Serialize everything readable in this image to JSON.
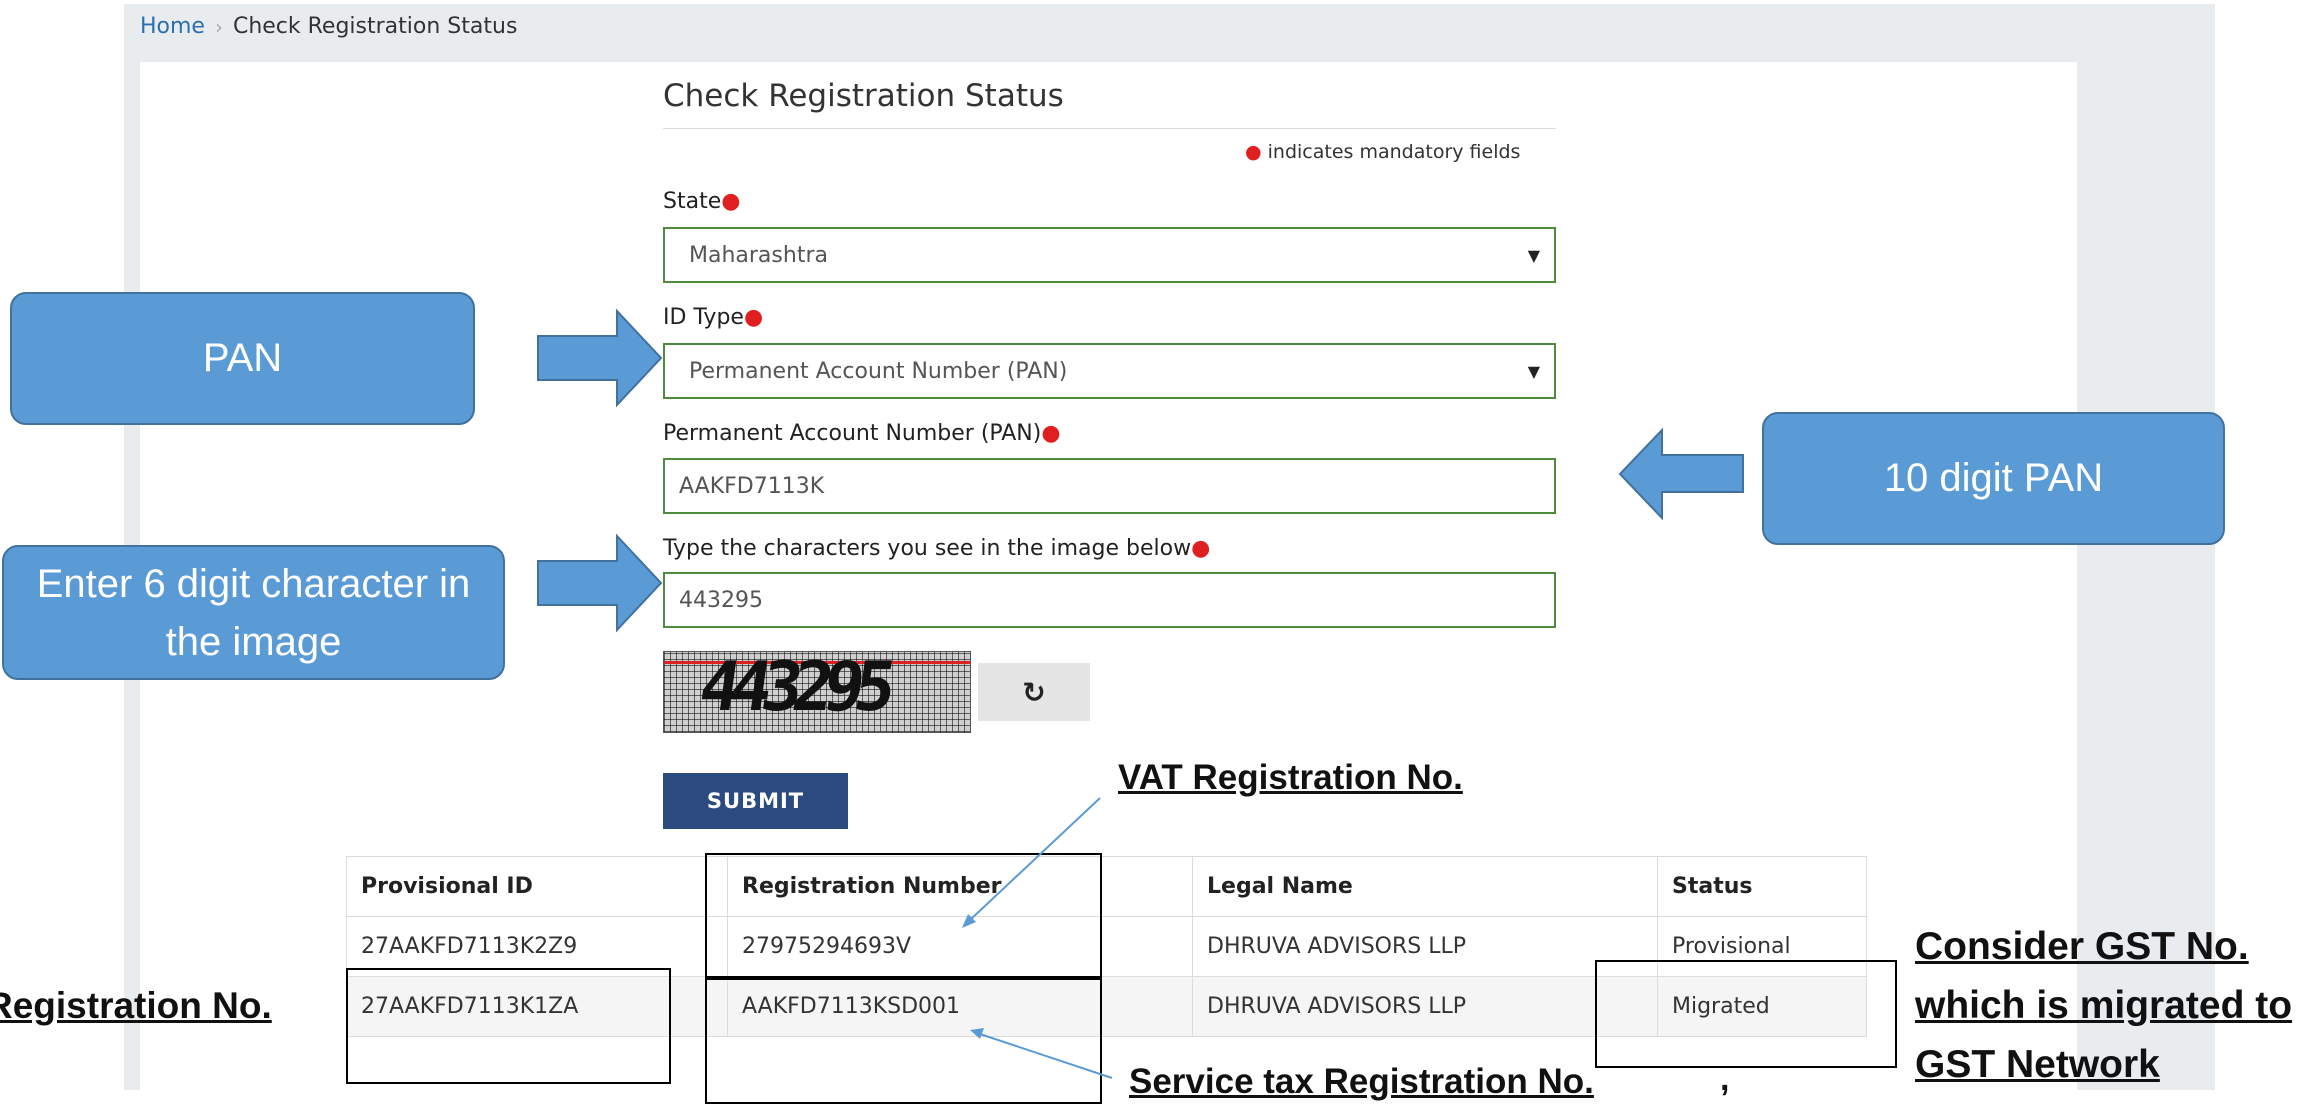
{
  "breadcrumb": {
    "home": "Home",
    "current": "Check Registration Status"
  },
  "form": {
    "title": "Check Registration Status",
    "mandatory_note": "indicates mandatory fields",
    "state_label": "State",
    "state_value": "Maharashtra",
    "id_type_label": "ID Type",
    "id_type_value": "Permanent Account Number (PAN)",
    "pan_label": "Permanent Account Number (PAN)",
    "pan_value": "AAKFD7113K",
    "captcha_label": "Type the characters you see in the image below",
    "captcha_value": "443295",
    "captcha_image_text": "443295",
    "refresh_icon": "refresh-icon",
    "submit_label": "SUBMIT"
  },
  "table": {
    "headers": [
      "Provisional ID",
      "Registration Number",
      "Legal Name",
      "Status"
    ],
    "rows": [
      [
        "27AAKFD7113K2Z9",
        "27975294693V",
        "DHRUVA ADVISORS LLP",
        "Provisional"
      ],
      [
        "27AAKFD7113K1ZA",
        "AAKFD7113KSD001",
        "DHRUVA ADVISORS LLP",
        "Migrated"
      ]
    ]
  },
  "annotations": {
    "callout_pan": "PAN",
    "callout_10digit": "10 digit PAN",
    "callout_captcha": "Enter 6 digit character in the image",
    "vat_label": "VAT Registration No.",
    "service_tax_label": "Service tax Registration No.",
    "left_label": "Registration No.",
    "consider_line1": "Consider GST No.",
    "consider_line2": "which is migrated to",
    "consider_line3": "GST Network",
    "stray_mark": ","
  },
  "colors": {
    "callout": "#5b9bd5",
    "field_border": "#4f8a3d",
    "submit": "#2b4a80",
    "mandatory": "#e02020",
    "link": "#2c6fb0"
  }
}
